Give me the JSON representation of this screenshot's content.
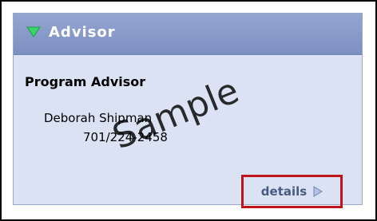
{
  "panel": {
    "title": "Advisor",
    "collapse_icon": "triangle-down-icon"
  },
  "advisor": {
    "heading": "Program Advisor",
    "name": "Deborah Shipman",
    "phone": "701/224-2458"
  },
  "details": {
    "label": "details",
    "arrow_icon": "triangle-right-icon"
  },
  "watermark": "Sample",
  "colors": {
    "header": "#8596c8",
    "panel_body": "#dbe2f3",
    "highlight_border": "#c0141b",
    "link": "#4b5a82",
    "collapse_icon": "#39d46a"
  }
}
